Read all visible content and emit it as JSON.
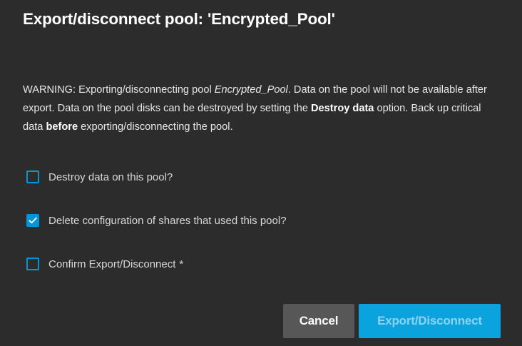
{
  "dialog": {
    "title": "Export/disconnect pool: 'Encrypted_Pool'",
    "warning": {
      "part1": "WARNING: Exporting/disconnecting pool ",
      "pool_name": "Encrypted_Pool",
      "part2": ". Data on the pool will not be available after export. Data on the pool disks can be destroyed by setting the ",
      "destroy_emphasis": "Destroy data",
      "part3": " option. Back up critical data ",
      "before_emphasis": "before",
      "part4": " exporting/disconnecting the pool."
    },
    "options": [
      {
        "label": "Destroy data on this pool?",
        "checked": false
      },
      {
        "label": "Delete configuration of shares that used this pool?",
        "checked": true
      },
      {
        "label": "Confirm Export/Disconnect",
        "checked": false,
        "required_marker": "*"
      }
    ],
    "buttons": {
      "cancel": "Cancel",
      "export": "Export/Disconnect"
    }
  },
  "colors": {
    "accent": "#0095d5",
    "background": "#2c2c2c",
    "cancel_button": "#575757",
    "export_button": "#0ba3de"
  }
}
